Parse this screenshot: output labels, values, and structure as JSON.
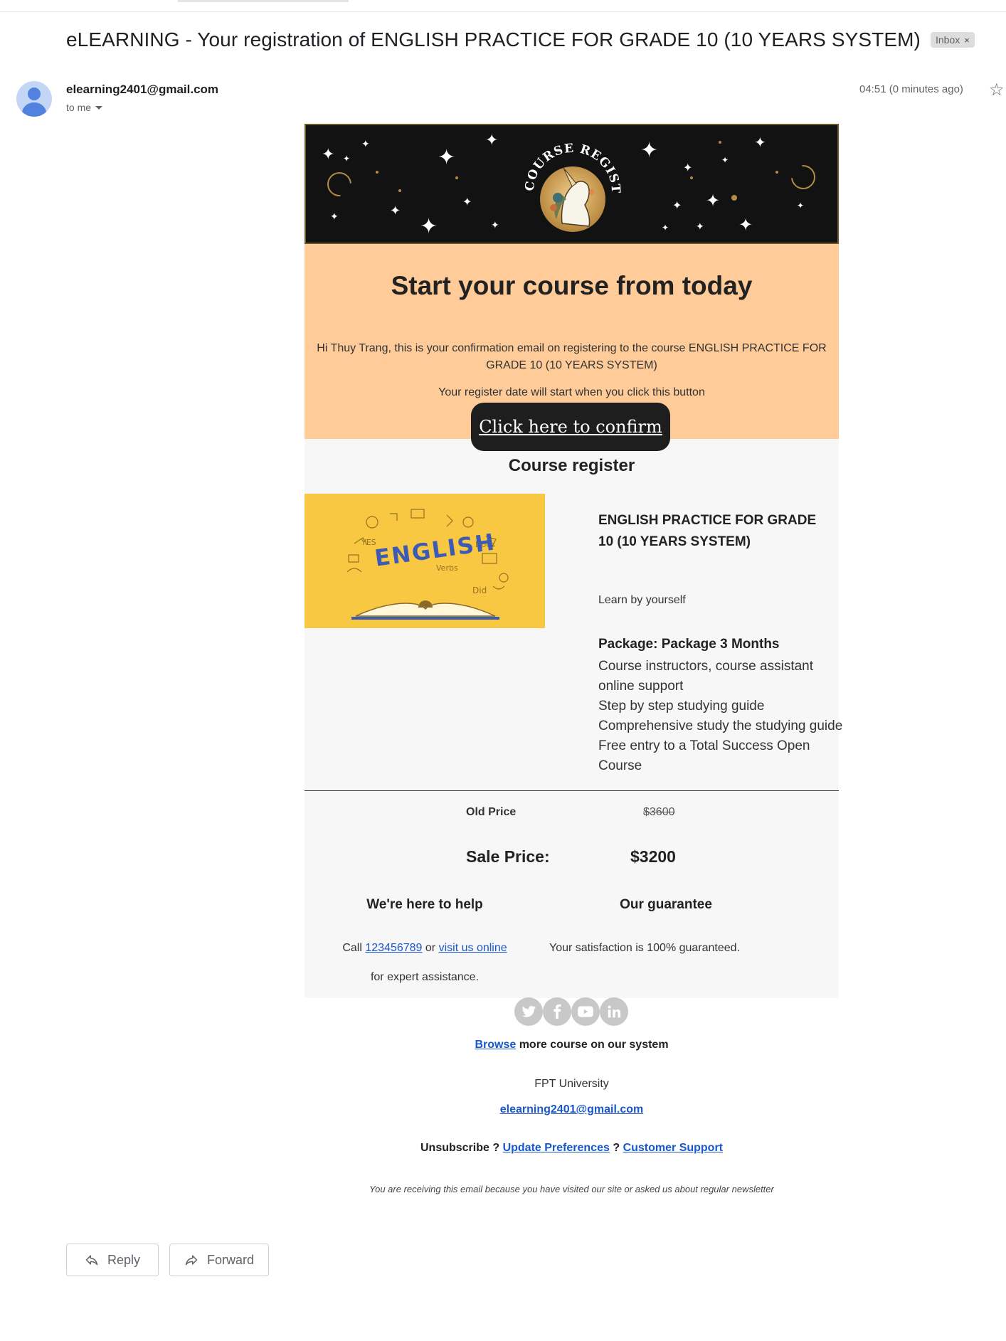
{
  "email": {
    "subject": "eLEARNING - Your registration of ENGLISH PRACTICE FOR GRADE 10 (10 YEARS SYSTEM)",
    "label_chip": "Inbox",
    "label_chip_close": "×",
    "sender": "elearning2401@gmail.com",
    "recipient": "to me",
    "timestamp": "04:51 (0 minutes ago)"
  },
  "banner": {
    "badge_text": "COURSE REGISTER"
  },
  "hero": {
    "title": "Start your course from today",
    "intro": "Hi Thuy Trang, this is your confirmation email on registering to the course ENGLISH PRACTICE FOR GRADE 10 (10 YEARS SYSTEM)",
    "note": "Your register date will start when you click this button",
    "confirm_label": "Click here to confirm"
  },
  "course": {
    "section_title": "Course register",
    "image_word": "ENGLISH",
    "name": "ENGLISH PRACTICE FOR GRADE 10 (10 YEARS SYSTEM)",
    "mode": "Learn by yourself",
    "package": "Package: Package 3 Months",
    "features": [
      "Course instructors, course assistant online support",
      "Step by step studying guide",
      "Comprehensive study the studying guide",
      "Free entry to a Total Success Open Course"
    ]
  },
  "pricing": {
    "old_label": "Old Price",
    "old_value": "$3600",
    "sale_label": "Sale Price:",
    "sale_value": "$3200"
  },
  "help": {
    "title": "We're here to help",
    "call_prefix": "Call",
    "phone": "123456789",
    "or": "or",
    "visit": "visit us online",
    "suffix": "for expert assistance."
  },
  "guarantee": {
    "title": "Our guarantee",
    "text": "Your satisfaction is 100% guaranteed."
  },
  "socials": [
    "twitter-icon",
    "facebook-icon",
    "youtube-icon",
    "linkedin-icon"
  ],
  "footer": {
    "browse_link": "Browse",
    "browse_rest": "more course on our system",
    "org": "FPT University",
    "email": "elearning2401@gmail.com",
    "unsubscribe": "Unsubscribe ?",
    "update_prefs": "Update Preferences",
    "q": "?",
    "support": "Customer Support",
    "disclaimer": "You are receiving this email because you have visited our site or asked us about regular newsletter"
  },
  "actions": {
    "reply": "Reply",
    "forward": "Forward"
  }
}
